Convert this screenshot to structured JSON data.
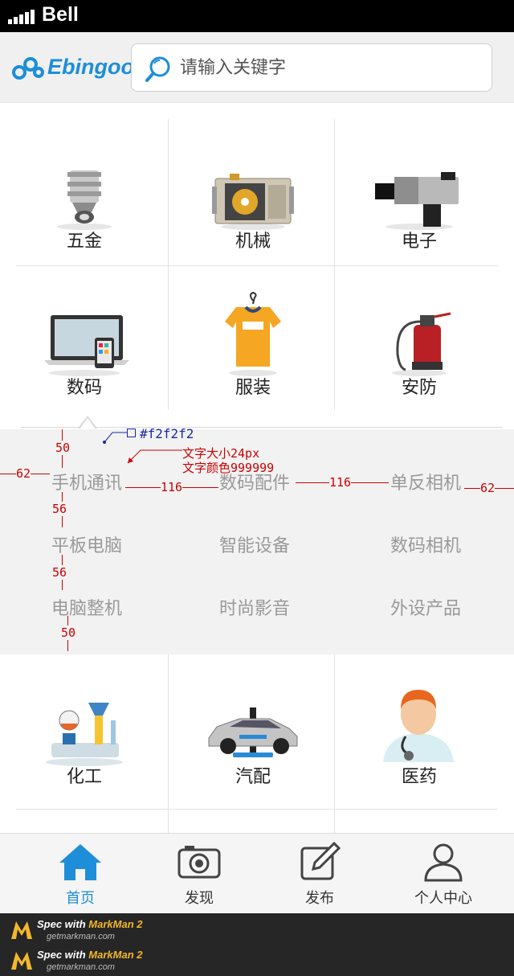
{
  "status_bar": {
    "carrier": "Bell"
  },
  "header": {
    "logo_text": "Ebingoo",
    "search_placeholder": "请输入关键字"
  },
  "categories": [
    {
      "label": "五金",
      "icon": "hardware-icon"
    },
    {
      "label": "机械",
      "icon": "machinery-icon"
    },
    {
      "label": "电子",
      "icon": "electronics-icon"
    },
    {
      "label": "数码",
      "icon": "digital-icon"
    },
    {
      "label": "服装",
      "icon": "clothing-icon"
    },
    {
      "label": "安防",
      "icon": "security-icon"
    },
    {
      "label": "化工",
      "icon": "chemical-icon"
    },
    {
      "label": "汽配",
      "icon": "auto-parts-icon"
    },
    {
      "label": "医药",
      "icon": "medicine-icon"
    }
  ],
  "subcategories": [
    [
      "手机通讯",
      "数码配件",
      "单反相机"
    ],
    [
      "平板电脑",
      "智能设备",
      "数码相机"
    ],
    [
      "电脑整机",
      "时尚影音",
      "外设产品"
    ]
  ],
  "spec_notes": {
    "bg_color": "#f2f2f2",
    "font_note_1": "文字大小24px",
    "font_note_2": "文字颜色999999",
    "dim_top": "50",
    "dim_left": "62",
    "dim_gap_1": "116",
    "dim_gap_2": "116",
    "dim_right": "62",
    "dim_row_1": "56",
    "dim_row_2": "56",
    "dim_bottom": "50"
  },
  "tabbar": [
    {
      "label": "首页",
      "icon": "home-icon",
      "active": true
    },
    {
      "label": "发现",
      "icon": "camera-icon",
      "active": false
    },
    {
      "label": "发布",
      "icon": "edit-icon",
      "active": false
    },
    {
      "label": "个人中心",
      "icon": "user-icon",
      "active": false
    }
  ],
  "footer": {
    "spec_prefix": "Spec with ",
    "brand": "MarkMan 2",
    "site": "getmarkman.com"
  },
  "colors": {
    "accent": "#1f8ed8",
    "sub_bg": "#f2f2f2",
    "sub_text": "#999999",
    "annotation": "#cc0000"
  }
}
